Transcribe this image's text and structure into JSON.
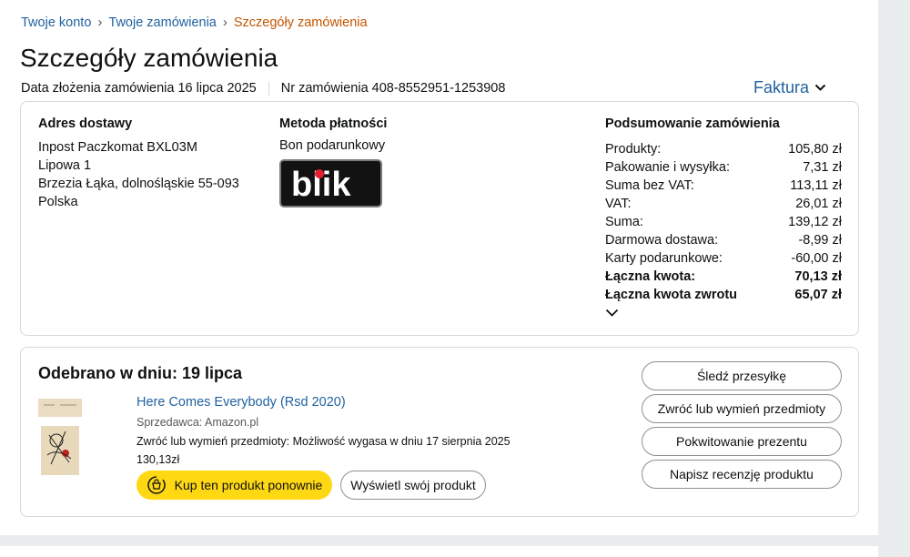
{
  "breadcrumb": {
    "account": "Twoje konto",
    "orders": "Twoje zamówienia",
    "current": "Szczegóły zamówienia",
    "separator": "›"
  },
  "page_title": "Szczegóły zamówienia",
  "order_meta": {
    "placed": "Data złożenia zamówienia 16 lipca 2025",
    "number": "Nr zamówienia 408-8552951-1253908"
  },
  "invoice": {
    "label": "Faktura",
    "icon": "chevron-down-icon"
  },
  "shipping": {
    "title": "Adres dostawy",
    "lines": [
      "Inpost Paczkomat BXL03M",
      "Lipowa 1",
      "Brzezia Łąka, dolnośląskie 55-093",
      "Polska"
    ]
  },
  "payment": {
    "title": "Metoda płatności",
    "method": "Bon podarunkowy",
    "logo_text": "blik"
  },
  "summary": {
    "title": "Podsumowanie zamówienia",
    "rows": [
      {
        "label": "Produkty:",
        "value": "105,80 zł"
      },
      {
        "label": "Pakowanie i wysyłka:",
        "value": "7,31 zł"
      },
      {
        "label": "Suma bez VAT:",
        "value": "113,11 zł"
      },
      {
        "label": "VAT:",
        "value": "26,01 zł"
      },
      {
        "label": "Suma:",
        "value": "139,12 zł"
      },
      {
        "label": "Darmowa dostawa:",
        "value": "-8,99 zł"
      },
      {
        "label": "Karty podarunkowe:",
        "value": "-60,00 zł"
      },
      {
        "label": "Łączna kwota:",
        "value": "70,13 zł"
      },
      {
        "label": "Łączna kwota zwrotu",
        "value": "65,07 zł"
      }
    ]
  },
  "shipment": {
    "status": "Odebrano w dniu: 19 lipca",
    "product": {
      "title": "Here Comes Everybody (Rsd 2020)",
      "seller": "Sprzedawca: Amazon.pl",
      "return_note": "Zwróć lub wymień przedmioty: Możliwość wygasa w dniu 17 sierpnia 2025",
      "price": "130,13zł"
    },
    "buy_again": "Kup ten produkt ponownie",
    "view_product": "Wyświetl swój produkt",
    "actions": {
      "track": "Śledź przesyłkę",
      "return": "Zwróć lub wymień przedmioty",
      "gift_receipt": "Pokwitowanie prezentu",
      "review": "Napisz recenzję produktu"
    }
  },
  "colors": {
    "link": "#2162a1",
    "breadcrumb_current": "#c45500",
    "buy_button": "#ffd814",
    "border": "#d5d9d9"
  }
}
